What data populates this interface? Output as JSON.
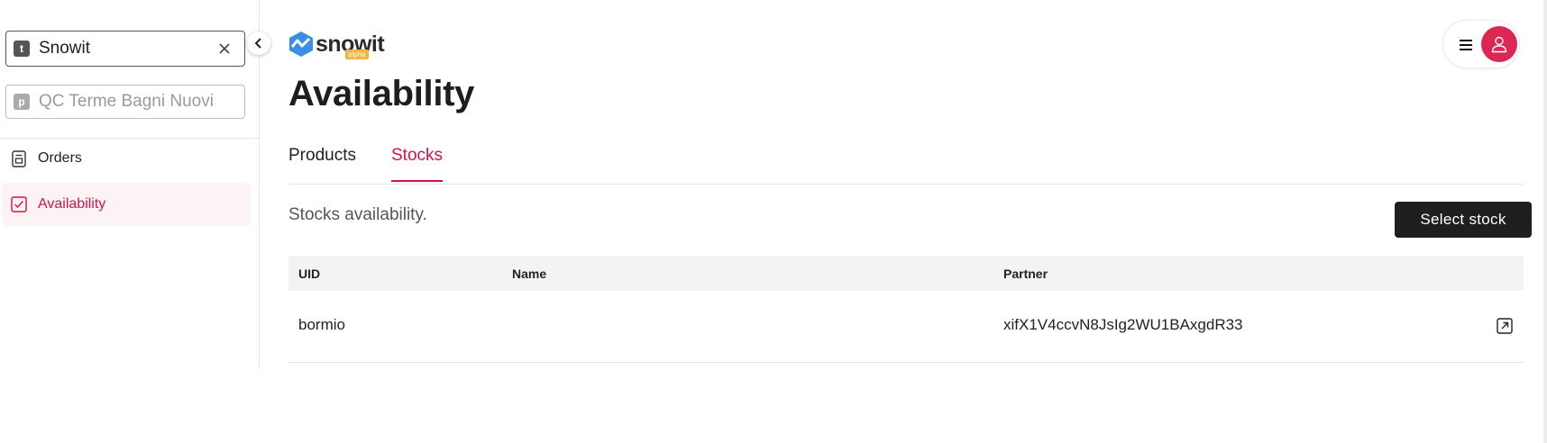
{
  "sidebar": {
    "tenant": {
      "badge": "t",
      "value": "Snowit"
    },
    "project": {
      "badge": "p",
      "placeholder": "QC Terme Bagni Nuovi"
    },
    "items": [
      {
        "label": "Orders",
        "icon": "document-icon",
        "active": false
      },
      {
        "label": "Availability",
        "icon": "checkbox-icon",
        "active": true
      }
    ]
  },
  "header": {
    "logo_text": "snowit",
    "logo_badge": "alpha",
    "page_title": "Availability"
  },
  "tabs": [
    {
      "label": "Products",
      "active": false
    },
    {
      "label": "Stocks",
      "active": true
    }
  ],
  "main": {
    "subtitle": "Stocks availability.",
    "select_button": "Select stock"
  },
  "table": {
    "columns": [
      "UID",
      "Name",
      "Partner"
    ],
    "rows": [
      {
        "uid": "bormio",
        "name": "",
        "partner": "xifX1V4ccvN8JsIg2WU1BAxgdR33"
      }
    ]
  },
  "colors": {
    "accent": "#d2134b",
    "avatar": "#dc2654",
    "logo_blue": "#3a8ee6",
    "badge_yellow": "#f4b73b"
  }
}
